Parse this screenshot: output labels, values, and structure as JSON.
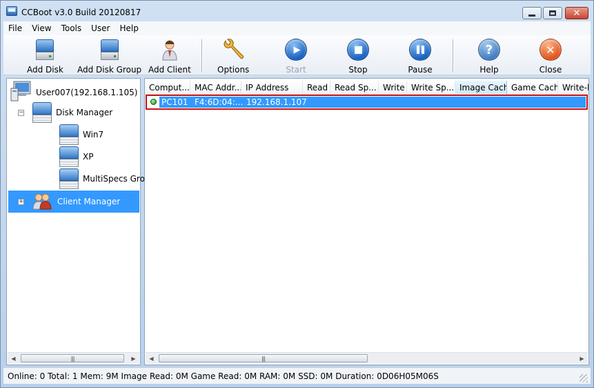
{
  "window": {
    "title": "CCBoot v3.0 Build 20120817"
  },
  "menu": [
    "File",
    "View",
    "Tools",
    "User",
    "Help"
  ],
  "toolbar": {
    "add_disk": "Add Disk",
    "add_disk_group": "Add Disk Group",
    "add_client": "Add Client",
    "options": "Options",
    "start": "Start",
    "stop": "Stop",
    "pause": "Pause",
    "help": "Help",
    "close": "Close"
  },
  "tree": {
    "server": "User007(192.168.1.105)",
    "disk_manager": "Disk Manager",
    "disks": [
      "Win7",
      "XP",
      "MultiSpecs Group"
    ],
    "client_manager": "Client Manager"
  },
  "list": {
    "columns": [
      "Comput...",
      "MAC Addr...",
      "IP Address",
      "Read",
      "Read Sp...",
      "Write",
      "Write Sp...",
      "Image Cache",
      "Game Cache",
      "Write-ba"
    ],
    "rows": [
      {
        "computer": "PC101",
        "mac": "F4:6D:04:...",
        "ip": "192.168.1.107"
      }
    ]
  },
  "status": {
    "text": "Online: 0 Total: 1 Mem: 9M Image Read: 0M Game Read: 0M RAM: 0M SSD: 0M Duration: 0D06H05M06S"
  },
  "colors": {
    "selection": "#3399ff",
    "highlight_border": "#cc1111"
  }
}
